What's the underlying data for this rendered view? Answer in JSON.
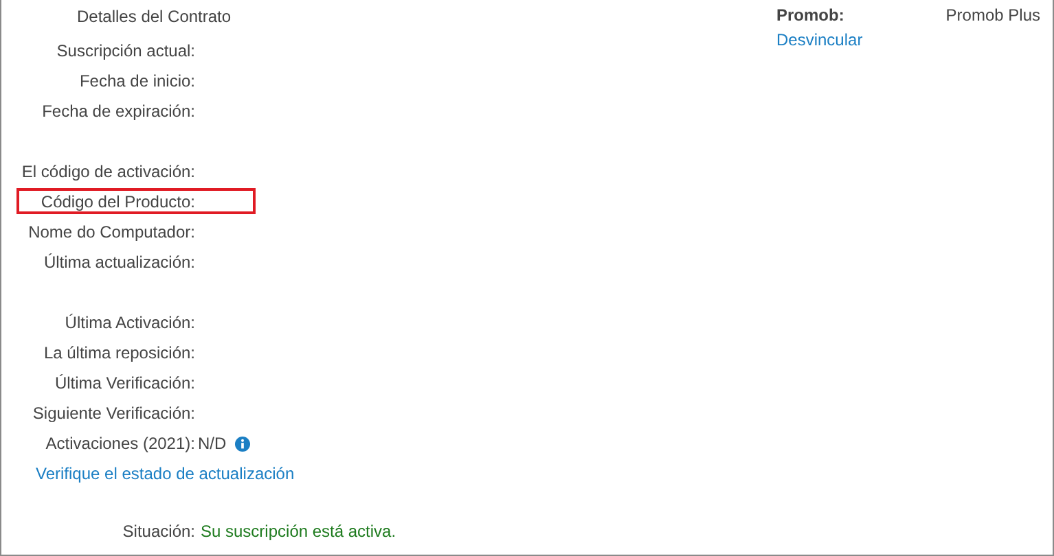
{
  "title": "Detalles del Contrato",
  "field_groups": [
    [
      {
        "label": "Suscripción actual:",
        "highlighted": false
      },
      {
        "label": "Fecha de inicio:",
        "highlighted": false
      },
      {
        "label": "Fecha de expiración:",
        "highlighted": false
      }
    ],
    [
      {
        "label": "El código de activación:",
        "highlighted": false
      },
      {
        "label": "Código del Producto:",
        "highlighted": true
      },
      {
        "label": "Nome do Computador:",
        "highlighted": false
      },
      {
        "label": "Última actualización:",
        "highlighted": false
      }
    ],
    [
      {
        "label": "Última Activación:",
        "highlighted": false
      },
      {
        "label": "La última reposición:",
        "highlighted": false
      },
      {
        "label": "Última Verificación:",
        "highlighted": false
      },
      {
        "label": "Siguiente Verificación:",
        "highlighted": false
      },
      {
        "label": "Activaciones (2021):",
        "value": "N/D",
        "highlighted": false,
        "info": true
      }
    ]
  ],
  "update_link": "Verifique el estado de actualización",
  "status": {
    "label": "Situación:",
    "value": "Su suscripción está activa."
  },
  "product": {
    "label": "Promob:",
    "value": "Promob Plus",
    "link": "Desvincular"
  }
}
